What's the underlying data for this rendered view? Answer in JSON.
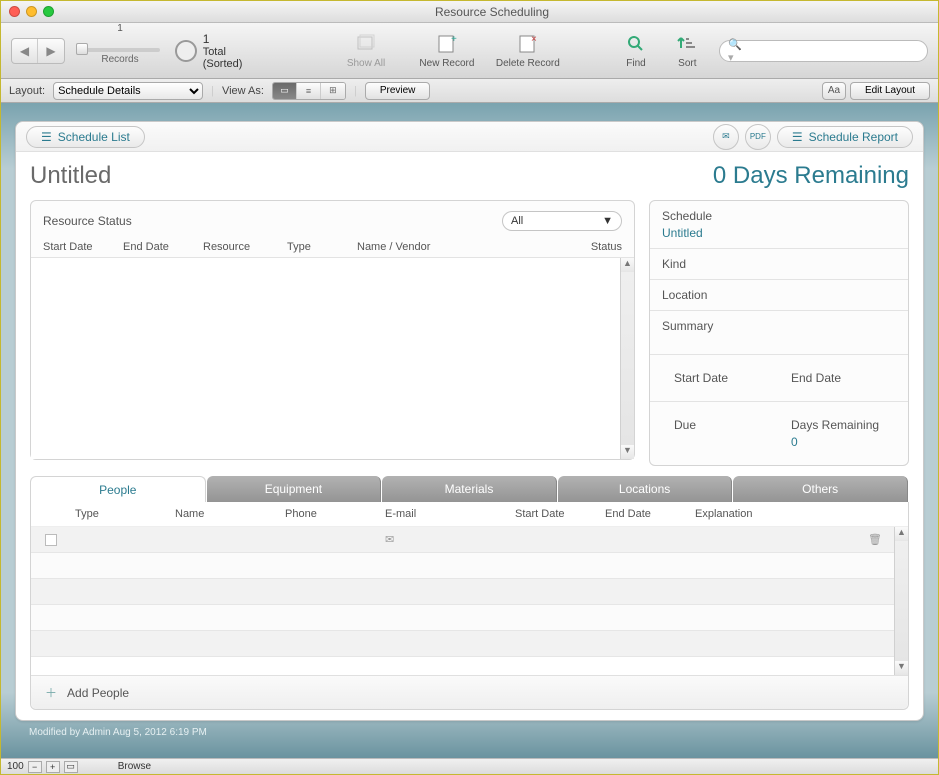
{
  "window": {
    "title": "Resource Scheduling"
  },
  "toolbar": {
    "record_number": "1",
    "records_count_line1": "1",
    "records_count_line2": "Total (Sorted)",
    "records_label": "Records",
    "show_all": "Show All",
    "new_record": "New Record",
    "delete_record": "Delete Record",
    "find": "Find",
    "sort": "Sort",
    "search_placeholder": ""
  },
  "subbar": {
    "layout_label": "Layout:",
    "layout_value": "Schedule Details",
    "view_as": "View As:",
    "preview": "Preview",
    "text_format_tooltip": "Aa",
    "edit_layout": "Edit Layout"
  },
  "header_buttons": {
    "schedule_list": "Schedule List",
    "pdf": "PDF",
    "schedule_report": "Schedule Report"
  },
  "main": {
    "title": "Untitled",
    "days_remaining_text": "0 Days Remaining",
    "resource_status_label": "Resource Status",
    "filter_value": "All",
    "columns": {
      "start_date": "Start Date",
      "end_date": "End Date",
      "resource": "Resource",
      "type": "Type",
      "name_vendor": "Name / Vendor",
      "status": "Status"
    }
  },
  "sidebar": {
    "schedule_label": "Schedule",
    "schedule_value": "Untitled",
    "kind_label": "Kind",
    "location_label": "Location",
    "summary_label": "Summary",
    "start_date_label": "Start Date",
    "end_date_label": "End Date",
    "due_label": "Due",
    "days_remaining_label": "Days Remaining",
    "days_remaining_value": "0"
  },
  "bottom_tabs": {
    "people": "People",
    "equipment": "Equipment",
    "materials": "Materials",
    "locations": "Locations",
    "others": "Others",
    "columns": {
      "type": "Type",
      "name": "Name",
      "phone": "Phone",
      "email": "E-mail",
      "start_date": "Start Date",
      "end_date": "End Date",
      "explanation": "Explanation"
    },
    "add_people": "Add People"
  },
  "footer": {
    "modified": "Modified by Admin Aug 5, 2012 6:19 PM"
  },
  "statusbar": {
    "zoom": "100",
    "mode": "Browse"
  },
  "colors": {
    "teal": "#2b7b8f"
  }
}
